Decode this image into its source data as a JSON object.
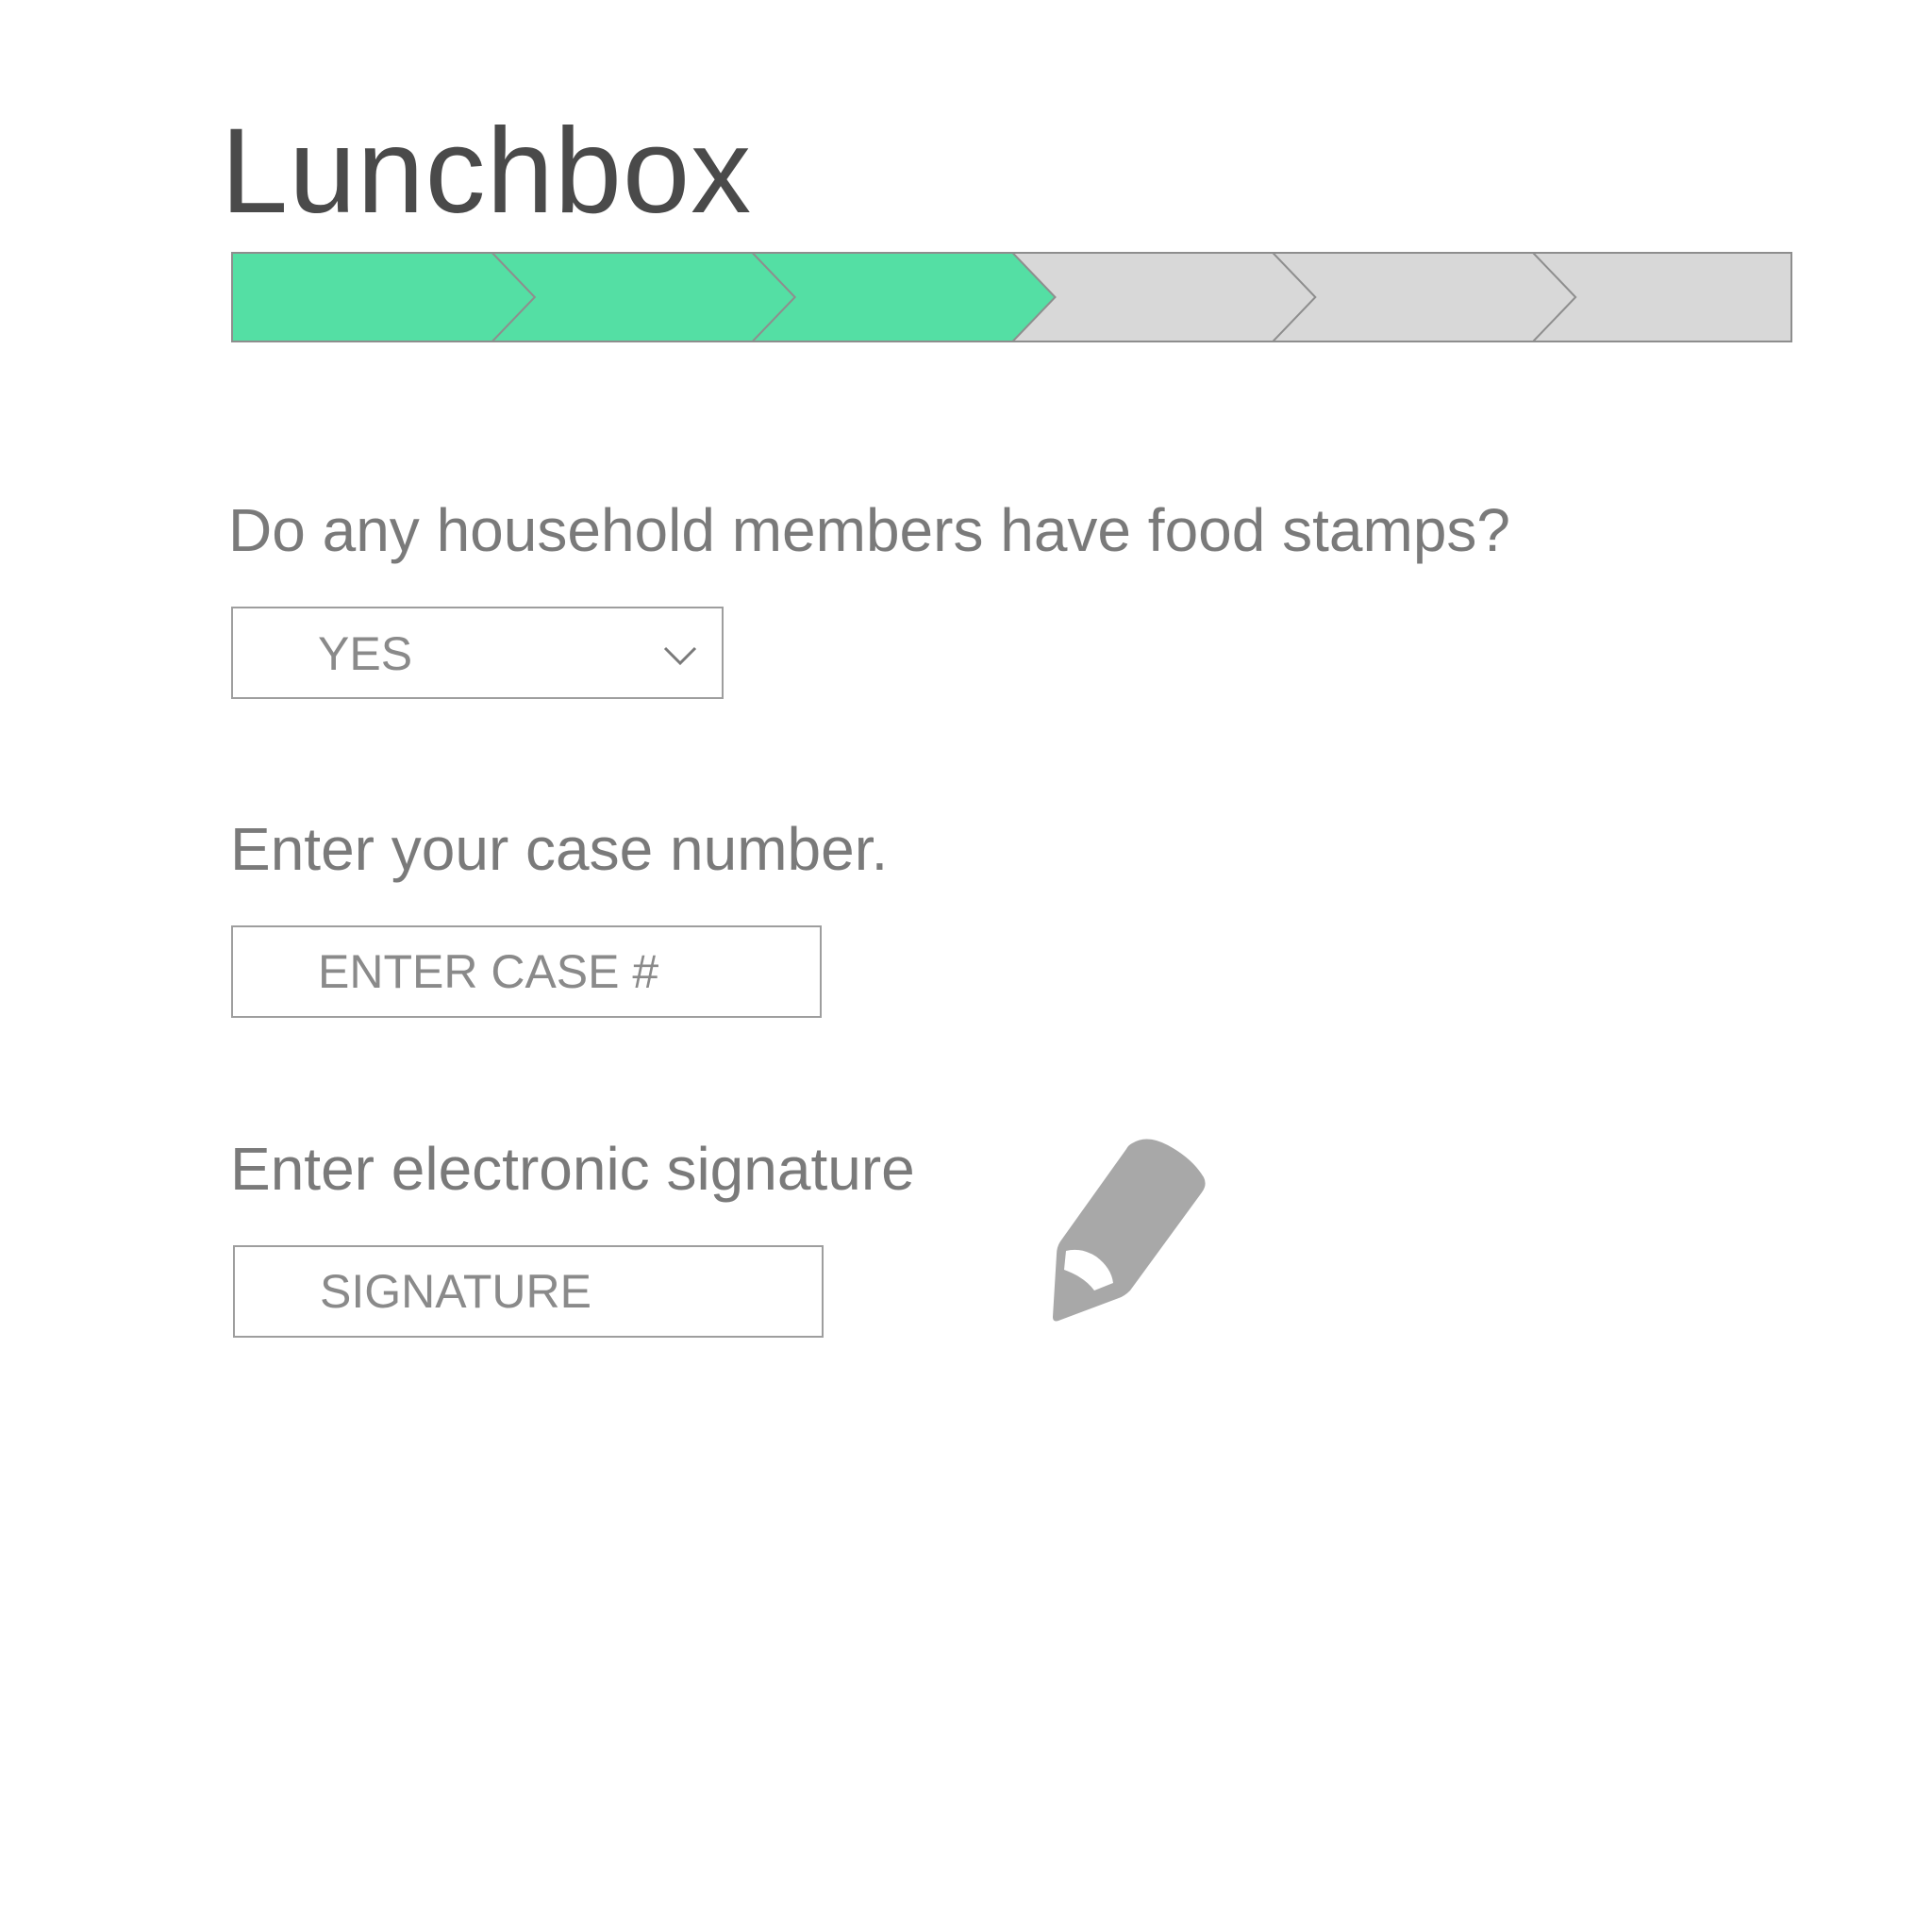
{
  "app": {
    "title": "Lunchbox"
  },
  "progress": {
    "total_steps": 6,
    "completed_steps": 3,
    "completed_color": "#54dfa4",
    "pending_color": "#d8d8d8",
    "border_color": "#8e8e8e"
  },
  "questions": {
    "food_stamps": {
      "label": "Do any household members have food stamps?",
      "selected_value": "YES",
      "icon": "chevron-down-icon"
    },
    "case_number": {
      "label": "Enter your case number.",
      "placeholder": "ENTER CASE #"
    },
    "signature": {
      "label": "Enter electronic signature",
      "placeholder": "SIGNATURE",
      "icon": "pencil-icon"
    }
  },
  "colors": {
    "title_text": "#4a4a4a",
    "label_text": "#7a7a7a",
    "field_text": "#8a8a8a",
    "field_border": "#9e9e9e",
    "icon_fill": "#a8a8a8"
  }
}
